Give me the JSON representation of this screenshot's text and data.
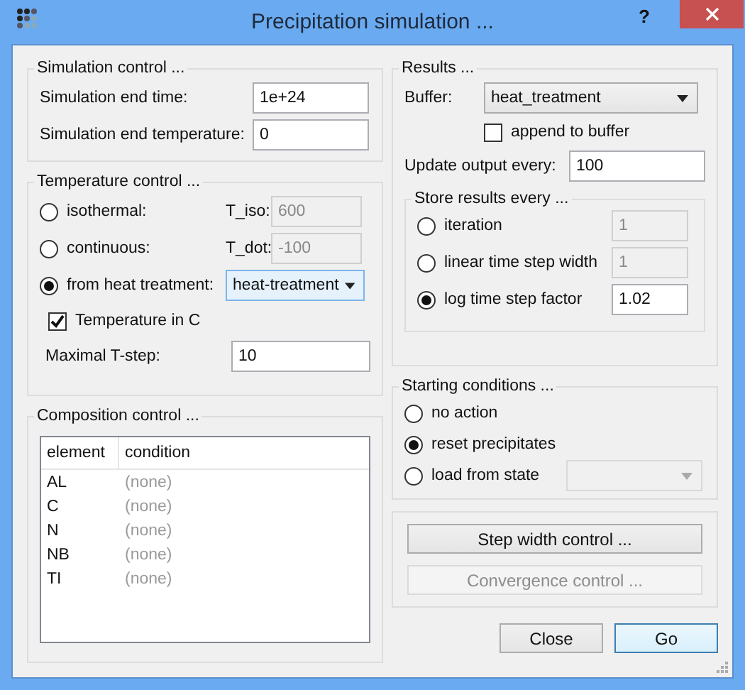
{
  "window": {
    "title": "Precipitation simulation ...",
    "help": "?"
  },
  "simulation_control": {
    "title": "Simulation control ...",
    "fields": [
      {
        "label": "Simulation end time:",
        "value": "1e+24"
      },
      {
        "label": "Simulation end temperature:",
        "value": "0"
      }
    ]
  },
  "temperature_control": {
    "title": "Temperature control ...",
    "modes": [
      {
        "kind": "field",
        "label": "isothermal:",
        "selected": false,
        "param_label": "T_iso:",
        "value": "600",
        "disabled": true
      },
      {
        "kind": "field",
        "label": "continuous:",
        "selected": false,
        "param_label": "T_dot:",
        "value": "-100",
        "disabled": true
      },
      {
        "kind": "dropdown",
        "label": "from heat treatment:",
        "selected": true,
        "value": "heat-treatment",
        "highlighted": true
      }
    ],
    "temperature_in_c": {
      "label": "Temperature in C",
      "checked": true
    },
    "max_t_step": {
      "label": "Maximal T-step:",
      "value": "10"
    }
  },
  "composition_control": {
    "title": "Composition control ...",
    "columns": [
      "element",
      "condition"
    ],
    "rows": [
      {
        "element": "AL",
        "condition": "(none)"
      },
      {
        "element": "C",
        "condition": "(none)"
      },
      {
        "element": "N",
        "condition": "(none)"
      },
      {
        "element": "NB",
        "condition": "(none)"
      },
      {
        "element": "TI",
        "condition": "(none)"
      }
    ]
  },
  "results": {
    "title": "Results ...",
    "buffer": {
      "label": "Buffer:",
      "value": "heat_treatment"
    },
    "append": {
      "label": "append to buffer",
      "checked": false
    },
    "update": {
      "label": "Update output every:",
      "value": "100"
    },
    "store": {
      "title": "Store results every ...",
      "options": [
        {
          "label": "iteration",
          "selected": false,
          "value": "1",
          "disabled": true
        },
        {
          "label": "linear time step width",
          "selected": false,
          "value": "1",
          "disabled": true
        },
        {
          "label": "log time step factor",
          "selected": true,
          "value": "1.02",
          "disabled": false
        }
      ]
    }
  },
  "starting_conditions": {
    "title": "Starting conditions ...",
    "options": [
      {
        "kind": "plain",
        "label": "no action",
        "selected": false
      },
      {
        "kind": "plain",
        "label": "reset precipitates",
        "selected": true
      },
      {
        "kind": "dropdown",
        "label": "load from state",
        "selected": false,
        "disabled": true
      }
    ]
  },
  "control_buttons": [
    {
      "label": "Step width control ...",
      "disabled": false
    },
    {
      "label": "Convergence control ...",
      "disabled": true
    }
  ],
  "footer_buttons": [
    {
      "label": "Close",
      "default": false
    },
    {
      "label": "Go",
      "default": true
    }
  ]
}
